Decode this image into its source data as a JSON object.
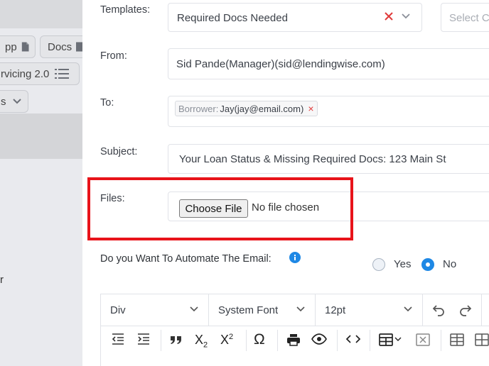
{
  "background": {
    "tabs": [
      {
        "label": "pp"
      },
      {
        "label": "Docs"
      },
      {
        "label": "rvicing 2.0"
      },
      {
        "label": "s"
      }
    ],
    "stray_char": "r"
  },
  "form": {
    "templates": {
      "label": "Templates:",
      "value": "Required Docs Needed",
      "secondary_placeholder": "Select C"
    },
    "from": {
      "label": "From:",
      "value": "Sid Pande(Manager)(sid@lendingwise.com)"
    },
    "to": {
      "label": "To:",
      "tag_key": "Borrower:",
      "tag_value": "Jay(jay@email.com)",
      "tag_remove": "×"
    },
    "subject": {
      "label": "Subject:",
      "value": "Your Loan Status & Missing Required Docs: 123 Main St"
    },
    "files": {
      "label": "Files:",
      "button": "Choose File",
      "status": "No file chosen"
    },
    "automate": {
      "label": "Do you Want To Automate The Email:",
      "yes": "Yes",
      "no": "No",
      "selected": "No"
    }
  },
  "editor": {
    "block_format": "Div",
    "font_family": "System Font",
    "font_size": "12pt"
  },
  "colors": {
    "accent": "#1e88e5",
    "highlight": "#e8131a",
    "remove": "#e03a3a"
  }
}
